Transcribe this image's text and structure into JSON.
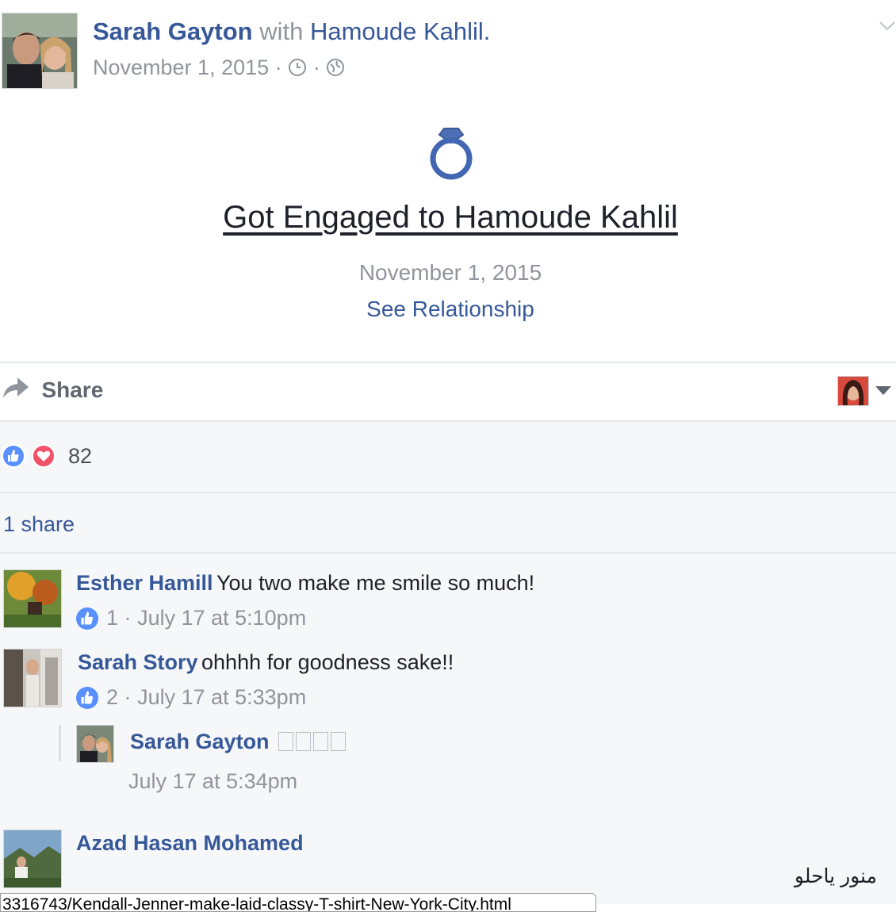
{
  "post": {
    "author": "Sarah Gayton",
    "with_word": "with",
    "tagged": "Hamoude Kahlil.",
    "date": "November 1, 2015",
    "separator": "·"
  },
  "life_event": {
    "title": "Got Engaged to Hamoude Kahlil",
    "date": "November 1, 2015",
    "link": "See Relationship",
    "icon": "ring-icon"
  },
  "actions": {
    "share_label": "Share"
  },
  "reactions": {
    "count": "82",
    "shares": "1 share"
  },
  "comments": [
    {
      "name": "Esther Hamill",
      "text": "You two make me smile so much!",
      "likes": "1",
      "sep": "·",
      "time": "July 17 at 5:10pm"
    },
    {
      "name": "Sarah Story",
      "text": "ohhhh for goodness sake!!",
      "likes": "2",
      "sep": "·",
      "time": "July 17 at 5:33pm"
    },
    {
      "name": "Azad Hasan Mohamed",
      "text": "منور ياحلو"
    }
  ],
  "reply": {
    "name": "Sarah Gayton",
    "time": "July 17 at 5:34pm"
  },
  "url_bar": {
    "text": "3316743/Kendall-Jenner-make-laid-classy-T-shirt-New-York-City.html"
  },
  "colors": {
    "link": "#365899",
    "muted": "#90949c",
    "like": "#5890ff",
    "love": "#f25268"
  }
}
